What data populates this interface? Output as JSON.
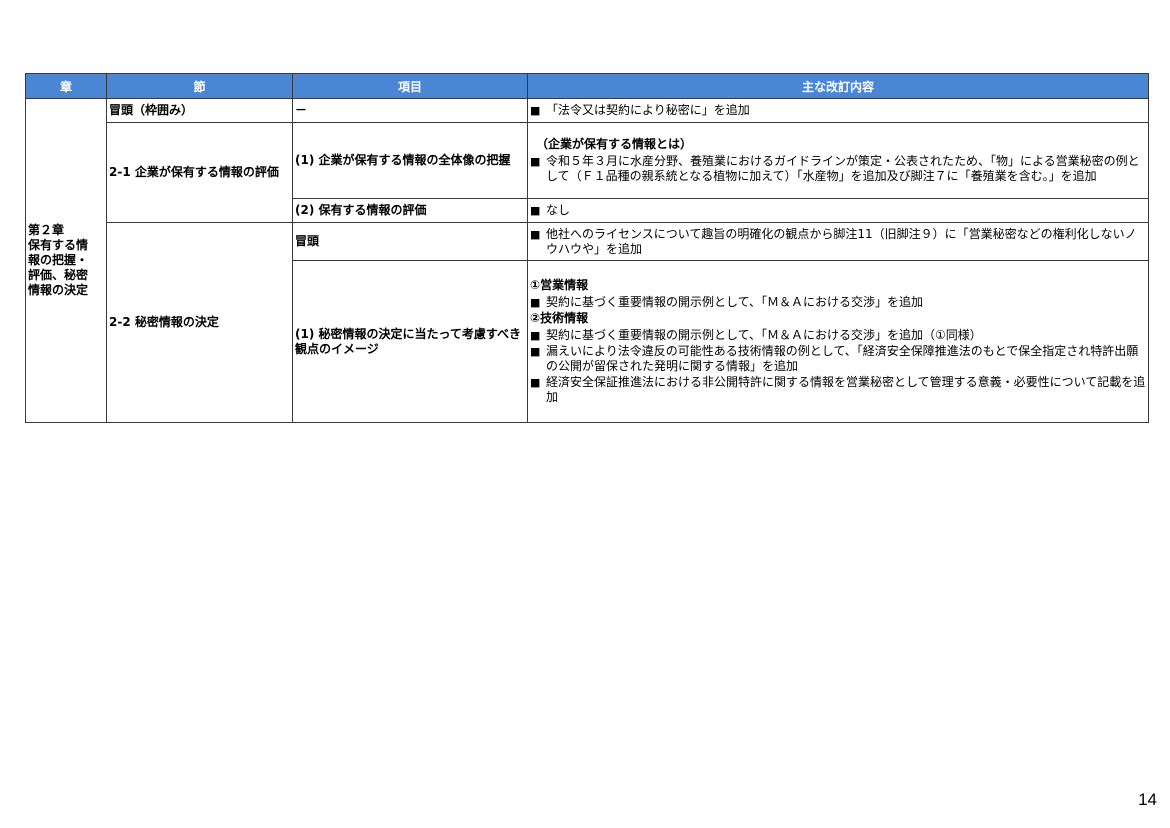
{
  "table": {
    "headers": {
      "chapter": "章",
      "section": "節",
      "item": "項目",
      "content": "主な改訂内容"
    },
    "chapter": [
      "第２章",
      "保有する情",
      "報の把握・",
      "評価、秘密",
      "情報の決定"
    ],
    "bullet_mark": "■",
    "rows": {
      "r1": {
        "section": "冒頭（枠囲み）",
        "item": "－",
        "bullets": [
          "「法令又は契約により秘密に」を追加"
        ]
      },
      "r2": {
        "section": "2-1 企業が保有する情報の評価",
        "item": "(1) 企業が保有する情報の全体像の把握",
        "heading": "（企業が保有する情報とは）",
        "bullets": [
          "令和５年３月に水産分野、養殖業におけるガイドラインが策定・公表されたため、「物」による営業秘密の例として（Ｆ１品種の親系統となる植物に加えて）「水産物」を追加及び脚注７に「養殖業を含む。」を追加"
        ]
      },
      "r3": {
        "item": "(2) 保有する情報の評価",
        "bullets": [
          "なし"
        ]
      },
      "r4": {
        "section": "2-2 秘密情報の決定",
        "item": "冒頭",
        "bullets": [
          "他社へのライセンスについて趣旨の明確化の観点から脚注11（旧脚注９）に「営業秘密などの権利化しないノウハウや」を追加"
        ]
      },
      "r5": {
        "item": "(1) 秘密情報の決定に当たって考慮すべき観点のイメージ",
        "heading1": "①営業情報",
        "bullets1": [
          "契約に基づく重要情報の開示例として、「Ｍ＆Ａにおける交渉」を追加"
        ],
        "heading2": "②技術情報",
        "bullets2": [
          "契約に基づく重要情報の開示例として、「Ｍ＆Ａにおける交渉」を追加（①同様）",
          "漏えいにより法令違反の可能性ある技術情報の例として、「経済安全保障推進法のもとで保全指定され特許出願の公開が留保された発明に関する情報」を追加",
          "経済安全保証推進法における非公開特許に関する情報を営業秘密として管理する意義・必要性について記載を追加"
        ]
      }
    }
  },
  "page_number": "14"
}
